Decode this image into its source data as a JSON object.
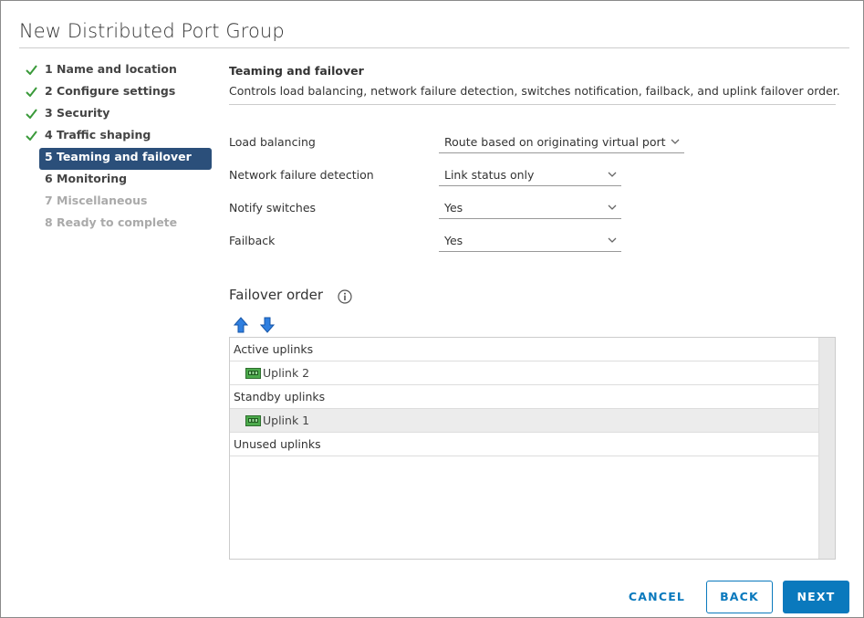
{
  "dialog": {
    "title": "New Distributed Port Group"
  },
  "steps": [
    {
      "label": "1 Name and location",
      "state": "done"
    },
    {
      "label": "2 Configure settings",
      "state": "done"
    },
    {
      "label": "3 Security",
      "state": "done"
    },
    {
      "label": "4 Traffic shaping",
      "state": "done"
    },
    {
      "label": "5 Teaming and failover",
      "state": "active"
    },
    {
      "label": "6 Monitoring",
      "state": "pending"
    },
    {
      "label": "7 Miscellaneous",
      "state": "disabled"
    },
    {
      "label": "8 Ready to complete",
      "state": "disabled"
    }
  ],
  "section": {
    "title": "Teaming and failover",
    "description": "Controls load balancing, network failure detection, switches notification, failback, and uplink failover order."
  },
  "form": {
    "load_balancing": {
      "label": "Load balancing",
      "value": "Route based on originating virtual port"
    },
    "network_failure_detection": {
      "label": "Network failure detection",
      "value": "Link status only"
    },
    "notify_switches": {
      "label": "Notify switches",
      "value": "Yes"
    },
    "failback": {
      "label": "Failback",
      "value": "Yes"
    }
  },
  "failover": {
    "title": "Failover order",
    "active_label": "Active uplinks",
    "active_items": [
      "Uplink 2"
    ],
    "standby_label": "Standby uplinks",
    "standby_items": [
      "Uplink 1"
    ],
    "unused_label": "Unused uplinks"
  },
  "footer": {
    "cancel": "CANCEL",
    "back": "BACK",
    "next": "NEXT"
  },
  "colors": {
    "accent": "#0a79bd",
    "active_step": "#2b4f7a",
    "check": "#3a9a3a",
    "arrow": "#1e6fd9"
  }
}
